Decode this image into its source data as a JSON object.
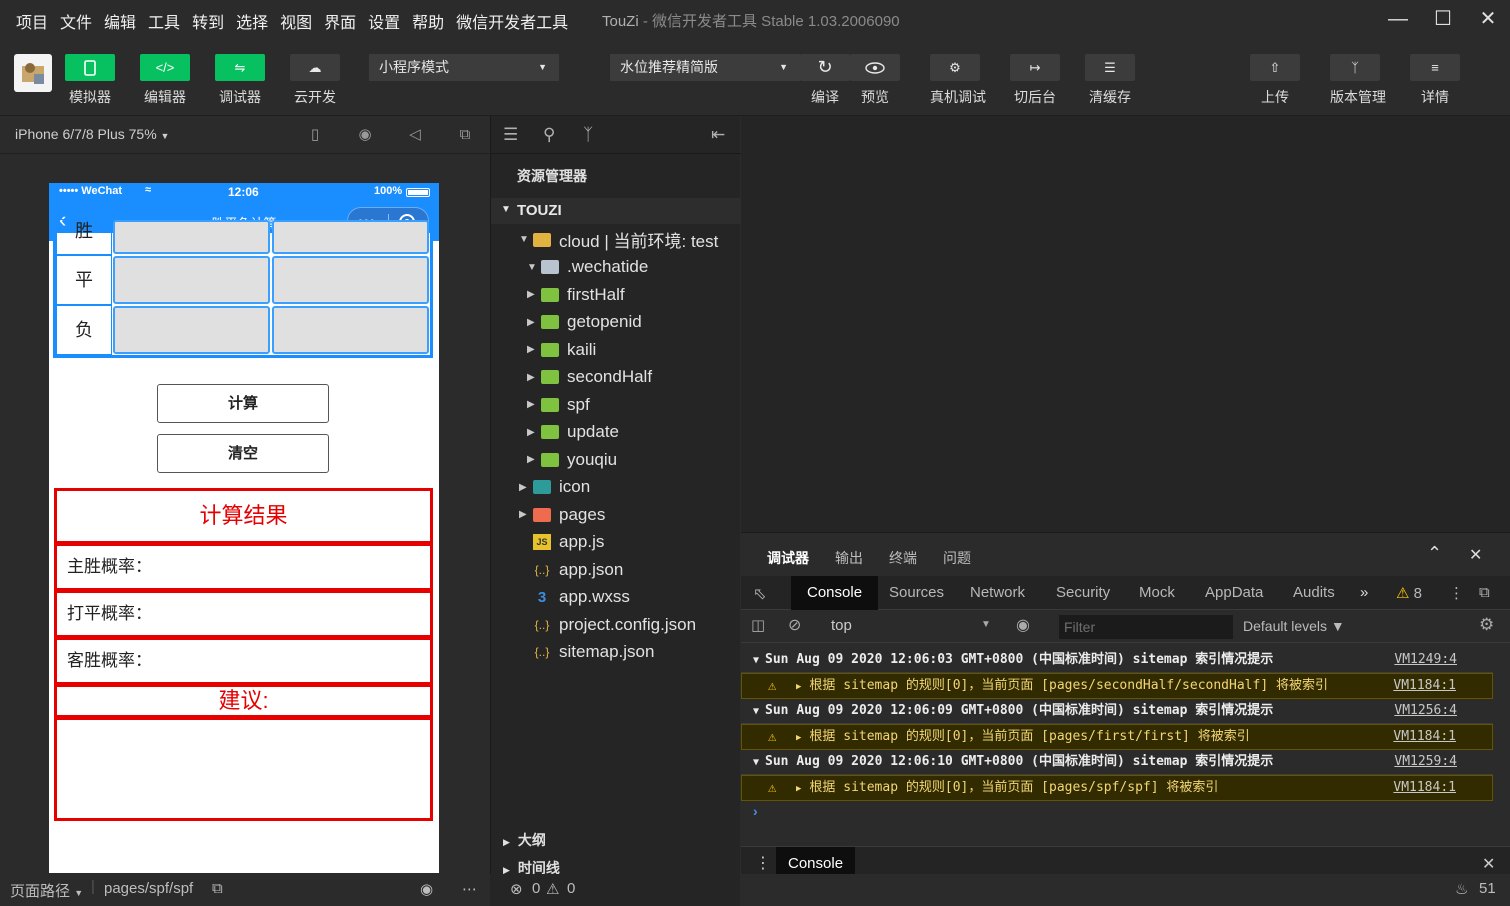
{
  "menu": {
    "items": [
      "项目",
      "文件",
      "编辑",
      "工具",
      "转到",
      "选择",
      "视图",
      "界面",
      "设置",
      "帮助",
      "微信开发者工具"
    ],
    "title_app": "TouZi",
    "title_rest": " - 微信开发者工具 Stable 1.03.2006090"
  },
  "toolbar": {
    "simulator": "模拟器",
    "editor": "编辑器",
    "debugger": "调试器",
    "cloud": "云开发",
    "mode_select": "小程序模式",
    "compile_select": "水位推荐精简版",
    "compile": "编译",
    "preview": "预览",
    "remote_debug": "真机调试",
    "background": "切后台",
    "clear_cache": "清缓存",
    "upload": "上传",
    "version": "版本管理",
    "details": "详情"
  },
  "simulator": {
    "device": "iPhone 6/7/8 Plus 75%",
    "status_left": "••••• WeChat",
    "status_time": "12:06",
    "status_battery": "100%",
    "page_title": "胜平负计算",
    "rows": [
      "胜",
      "平",
      "负"
    ],
    "calc_button": "计算",
    "clear_button": "清空",
    "result_title": "计算结果",
    "home_win": "主胜概率：",
    "draw": "打平概率：",
    "away_win": "客胜概率：",
    "advice": "建议:"
  },
  "explorer": {
    "header": "资源管理器",
    "project": "TOUZI",
    "tree": [
      {
        "name": "cloud | 当前环境: test",
        "type": "folder-open",
        "depth": 1,
        "arrow": "down"
      },
      {
        "name": ".wechatide",
        "type": "folder-gray",
        "depth": 2,
        "arrow": "down"
      },
      {
        "name": "firstHalf",
        "type": "folder-green",
        "depth": 2,
        "arrow": "right"
      },
      {
        "name": "getopenid",
        "type": "folder-green",
        "depth": 2,
        "arrow": "right"
      },
      {
        "name": "kaili",
        "type": "folder-green",
        "depth": 2,
        "arrow": "right"
      },
      {
        "name": "secondHalf",
        "type": "folder-green",
        "depth": 2,
        "arrow": "right"
      },
      {
        "name": "spf",
        "type": "folder-green",
        "depth": 2,
        "arrow": "right"
      },
      {
        "name": "update",
        "type": "folder-green",
        "depth": 2,
        "arrow": "right"
      },
      {
        "name": "youqiu",
        "type": "folder-green",
        "depth": 2,
        "arrow": "right"
      },
      {
        "name": "icon",
        "type": "folder-teal",
        "depth": 1,
        "arrow": "right"
      },
      {
        "name": "pages",
        "type": "folder-red",
        "depth": 1,
        "arrow": "right"
      },
      {
        "name": "app.js",
        "type": "file-js",
        "depth": 1,
        "arrow": ""
      },
      {
        "name": "app.json",
        "type": "file-json",
        "depth": 1,
        "arrow": ""
      },
      {
        "name": "app.wxss",
        "type": "file-css",
        "depth": 1,
        "arrow": ""
      },
      {
        "name": "project.config.json",
        "type": "file-json",
        "depth": 1,
        "arrow": ""
      },
      {
        "name": "sitemap.json",
        "type": "file-json",
        "depth": 1,
        "arrow": ""
      }
    ],
    "outline": "大纲",
    "timeline": "时间线"
  },
  "debug": {
    "tabs": [
      "调试器",
      "输出",
      "终端",
      "问题"
    ],
    "devtools_tabs": [
      "Console",
      "Sources",
      "Network",
      "Security",
      "Mock",
      "AppData",
      "Audits"
    ],
    "more": "»",
    "warn_count": "8",
    "context": "top",
    "filter_placeholder": "Filter",
    "levels": "Default levels",
    "logs": [
      {
        "kind": "head",
        "text": "Sun Aug 09 2020 12:06:03 GMT+0800 (中国标准时间) sitemap 索引情况提示",
        "link": "VM1249:4"
      },
      {
        "kind": "warn",
        "text": "根据 sitemap 的规则[0]，当前页面 [pages/secondHalf/secondHalf] 将被索引",
        "link": "VM1184:1"
      },
      {
        "kind": "head",
        "text": "Sun Aug 09 2020 12:06:09 GMT+0800 (中国标准时间) sitemap 索引情况提示",
        "link": "VM1256:4"
      },
      {
        "kind": "warn",
        "text": "根据 sitemap 的规则[0]，当前页面 [pages/first/first] 将被索引",
        "link": "VM1184:1"
      },
      {
        "kind": "head",
        "text": "Sun Aug 09 2020 12:06:10 GMT+0800 (中国标准时间) sitemap 索引情况提示",
        "link": "VM1259:4"
      },
      {
        "kind": "warn",
        "text": "根据 sitemap 的规则[0]，当前页面 [pages/spf/spf] 将被索引",
        "link": "VM1184:1"
      }
    ],
    "drawer_tab": "Console"
  },
  "statusbar": {
    "path_label": "页面路径",
    "path": "pages/spf/spf",
    "errors": "0",
    "warnings": "0",
    "notifications": "51"
  },
  "colors": {
    "accent_green": "#07c160",
    "wechat_blue": "#1a8dff",
    "result_red": "#e60000"
  }
}
